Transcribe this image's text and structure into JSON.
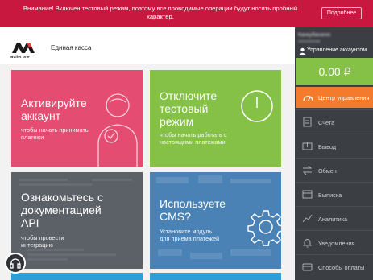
{
  "banner": {
    "text": "Внимание! Включен тестовый режим, поэтому все проводимые операции будут носить пробный характер.",
    "button_label": "Подробнее"
  },
  "header": {
    "logo_text": "wallet one",
    "title": "Единая касса"
  },
  "tiles": [
    {
      "title": "Активируйте аккаунт",
      "lines": [
        "Активируйте",
        "аккаунт"
      ],
      "sub": [
        "чтобы начать принимать",
        "платежи"
      ],
      "color": "#e54c72"
    },
    {
      "title": "Отключите тестовый режим",
      "lines": [
        "Отключите",
        "тестовый",
        "режим"
      ],
      "sub": [
        "чтобы начать работать с",
        "настоящими платежами"
      ],
      "color": "#84c146"
    },
    {
      "title": "Ознакомьтесь с документацией API",
      "lines": [
        "Ознакомьтесь с",
        "документацией",
        "API"
      ],
      "sub": [
        "чтобы провести",
        "интеграцию"
      ],
      "color": "#5c6067"
    },
    {
      "title": "Используете CMS?",
      "lines": [
        "Используете",
        "CMS?"
      ],
      "sub": [
        "Установите модуль",
        "для приема платежей"
      ],
      "color": "#4a82b5"
    }
  ],
  "account": {
    "name": "Канкубанагес",
    "sub": "пополнение",
    "manage_label": "Управление аккаунтом",
    "balance": "0.00 ₽"
  },
  "nav": {
    "main_label": "Центр управления",
    "items": [
      {
        "label": "Счета",
        "icon": "invoice-icon"
      },
      {
        "label": "Вывод",
        "icon": "withdraw-icon"
      },
      {
        "label": "Обмен",
        "icon": "exchange-icon"
      },
      {
        "label": "Выписка",
        "icon": "statement-icon"
      },
      {
        "label": "Аналитика",
        "icon": "analytics-icon"
      },
      {
        "label": "Уведомления",
        "icon": "bell-icon"
      },
      {
        "label": "Способы оплаты",
        "icon": "payment-icon"
      }
    ]
  },
  "colors": {
    "banner": "#c8183f",
    "pink": "#e54c72",
    "green": "#84c146",
    "gray": "#5c6067",
    "blue": "#4a82b5",
    "orange": "#f47b2b",
    "sidebar": "#3b3e42"
  }
}
